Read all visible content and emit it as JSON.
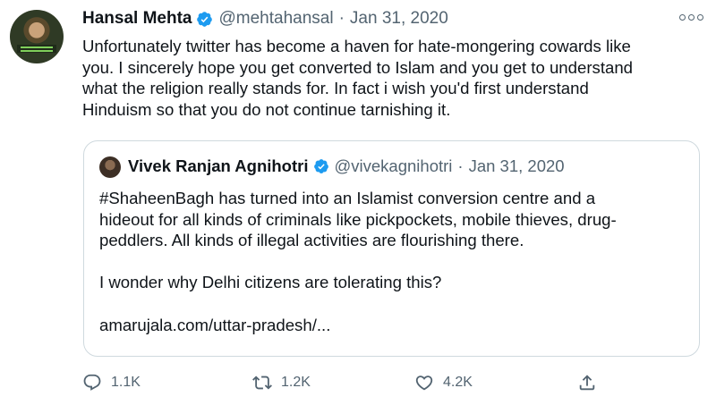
{
  "tweet": {
    "author_name": "Hansal Mehta",
    "handle": "@mehtahansal",
    "separator": "·",
    "date": "Jan 31, 2020",
    "text_lines": [
      "Unfortunately twitter has become a haven for hate-mongering cowards like",
      "you. I sincerely hope you get converted to Islam and you get to understand",
      "what the religion really stands for. In fact i wish you'd first understand",
      "Hinduism so that you do not continue tarnishing it."
    ],
    "more_icon": "more-horizontal-icon"
  },
  "quoted_tweet": {
    "author_name": "Vivek Ranjan Agnihotri",
    "handle": "@vivekagnihotri",
    "separator": "·",
    "date": "Jan 31, 2020",
    "text_lines": [
      "#ShaheenBagh has turned into an Islamist conversion centre and a",
      "hideout for all kinds of criminals like pickpockets, mobile thieves, drug-",
      "peddlers. All kinds of illegal activities are flourishing there."
    ],
    "question_line": "I wonder why Delhi citizens are tolerating this?",
    "link_line": "amarujala.com/uttar-pradesh/..."
  },
  "actions": {
    "reply_count": "1.1K",
    "retweet_count": "1.2K",
    "like_count": "4.2K"
  },
  "colors": {
    "verified_badge": "#1d9bf0",
    "secondary_text": "#536471",
    "border": "#cfd9de"
  }
}
